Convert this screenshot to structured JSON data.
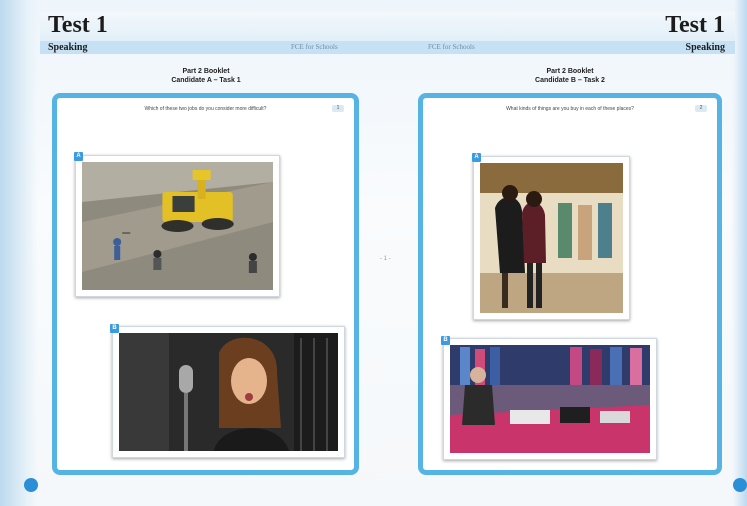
{
  "header": {
    "title_left": "Test 1",
    "subtitle_left": "Speaking",
    "title_right": "Test 1",
    "subtitle_right": "Speaking",
    "mid_label_left": "FCE for Schools",
    "mid_label_right": "FCE for Schools"
  },
  "colors": {
    "panel_border": "#56b4e4",
    "badge": "#3a9be0",
    "header_band": "#c5e1f3"
  },
  "left_booklet": {
    "heading_line1": "Part 2 Booklet",
    "heading_line2": "Candidate A – Task 1",
    "question": "Which of these two jobs do you consider more difficult?",
    "question_tag": "1",
    "photos": [
      {
        "badge": "A",
        "icon": "construction-site-photo"
      },
      {
        "badge": "B",
        "icon": "recording-studio-singer-photo"
      }
    ]
  },
  "right_booklet": {
    "heading_line1": "Part 2 Booklet",
    "heading_line2": "Candidate B – Task 2",
    "question": "What kinds of things are you buy in each of these places?",
    "question_tag": "2",
    "photos": [
      {
        "badge": "A",
        "icon": "clothes-shop-window-photo"
      },
      {
        "badge": "B",
        "icon": "street-market-stall-photo"
      }
    ]
  },
  "page_center_mark": "- 1 -"
}
